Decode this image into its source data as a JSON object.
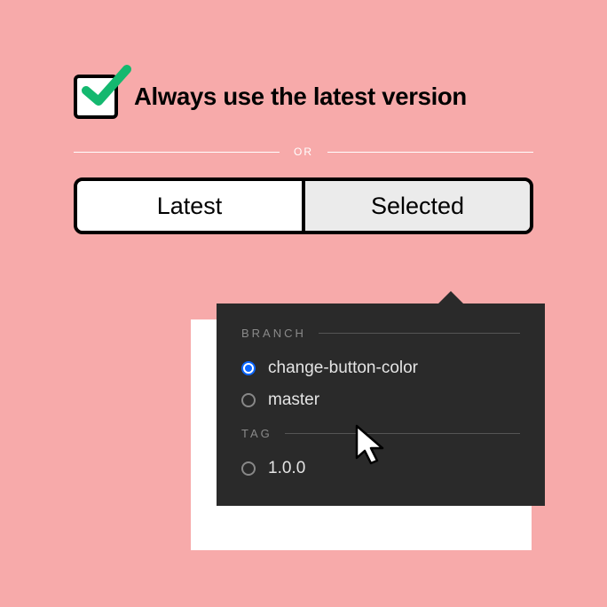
{
  "checkbox": {
    "label": "Always use the latest version",
    "checked": true
  },
  "divider": {
    "label": "OR"
  },
  "toggle": {
    "options": [
      "Latest",
      "Selected"
    ],
    "selected": "Selected"
  },
  "popover": {
    "sections": [
      {
        "label": "BRANCH",
        "options": [
          {
            "label": "change-button-color",
            "selected": true
          },
          {
            "label": "master",
            "selected": false
          }
        ]
      },
      {
        "label": "TAG",
        "options": [
          {
            "label": "1.0.0",
            "selected": false
          }
        ]
      }
    ]
  },
  "colors": {
    "background": "#f7aaaa",
    "accent": "#14b86f",
    "radio_selected": "#0a66ff",
    "popover_bg": "#2a2a2a"
  }
}
